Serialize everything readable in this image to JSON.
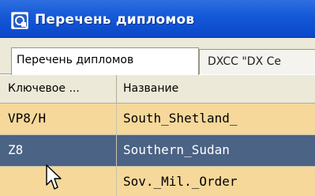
{
  "window": {
    "title": "Перечень дипломов",
    "icon": "app-window-icon"
  },
  "tabs": [
    {
      "label": "Перечень дипломов",
      "active": true
    },
    {
      "label": "DXCC \"DX Ce",
      "active": false
    }
  ],
  "grid": {
    "columns": [
      "Ключевое ...",
      "Название"
    ],
    "rows": [
      {
        "key": "VP8/H",
        "name": "South_Shetland_",
        "selected": false
      },
      {
        "key": "Z8",
        "name": "Southern_Sudan",
        "selected": true
      },
      {
        "key": "",
        "name": "Sov._Mil._Order",
        "selected": false
      }
    ]
  },
  "colors": {
    "titlebar": "#1458d8",
    "row_fill": "#f5d89a",
    "selected_row": "#4b6384"
  }
}
